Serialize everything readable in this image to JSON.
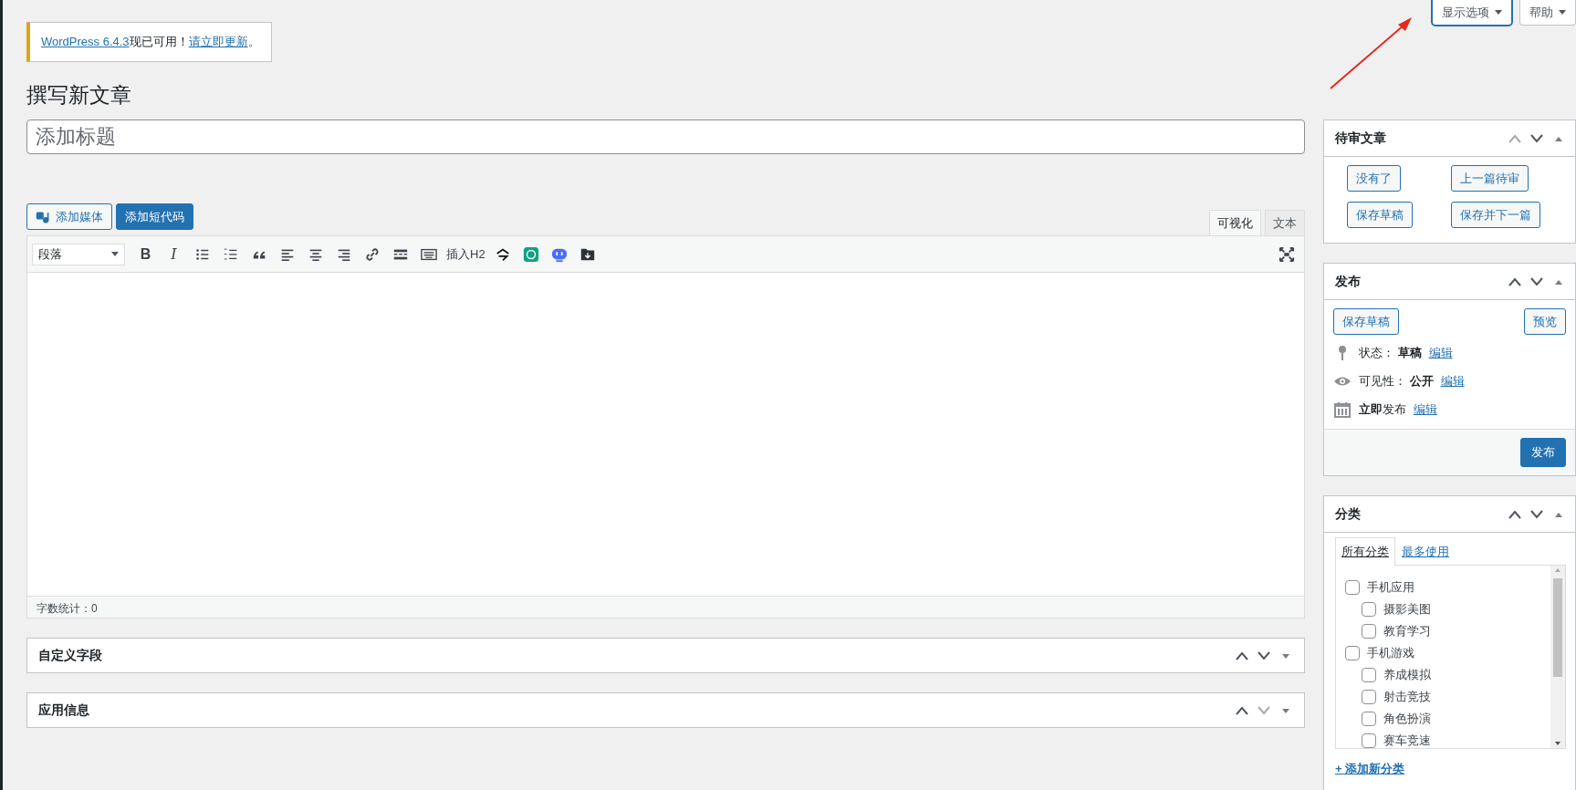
{
  "notice": {
    "parts": [
      {
        "kind": "link",
        "text": "WordPress 6.4.3"
      },
      {
        "kind": "text",
        "text": "现已可用！"
      },
      {
        "kind": "link",
        "text": "请立即更新"
      },
      {
        "kind": "text",
        "text": "。"
      }
    ]
  },
  "screen_meta": [
    {
      "label": "显示选项",
      "focused": true
    },
    {
      "label": "帮助",
      "focused": false
    }
  ],
  "heading": "撰写新文章",
  "title_field": {
    "placeholder": "添加标题"
  },
  "media_buttons": [
    {
      "label": "添加媒体",
      "kind": "media"
    },
    {
      "label": "添加短代码",
      "kind": "primary"
    }
  ],
  "editor_tabs": [
    {
      "label": "可视化",
      "selected": true
    },
    {
      "label": "文本",
      "selected": false
    }
  ],
  "toolbar": {
    "format_select": "段落",
    "items": [
      {
        "kind": "bold",
        "glyph": "B"
      },
      {
        "kind": "italic",
        "glyph": "I"
      },
      {
        "kind": "bullet-list"
      },
      {
        "kind": "number-list"
      },
      {
        "kind": "quote"
      },
      {
        "kind": "align-left"
      },
      {
        "kind": "align-center"
      },
      {
        "kind": "align-right"
      },
      {
        "kind": "link"
      },
      {
        "kind": "more"
      },
      {
        "kind": "keyboard"
      },
      {
        "kind": "text",
        "label": "插入H2"
      },
      {
        "kind": "squiggle"
      },
      {
        "kind": "chat"
      },
      {
        "kind": "robot"
      },
      {
        "kind": "download"
      }
    ]
  },
  "word_count": "字数统计：0",
  "postboxes": [
    {
      "title": "自定义字段",
      "up_disabled": false,
      "down_disabled": false
    },
    {
      "title": "应用信息",
      "up_disabled": false,
      "down_disabled": true
    }
  ],
  "sidebar": {
    "pending": {
      "title": "待审文章",
      "up_disabled": true,
      "down_disabled": false,
      "buttons": [
        "没有了",
        "上一篇待审",
        "保存草稿",
        "保存并下一篇"
      ]
    },
    "publish": {
      "title": "发布",
      "up_disabled": false,
      "down_disabled": false,
      "save_draft": "保存草稿",
      "preview": "预览",
      "rows": [
        {
          "kind": "status",
          "text": "状态： **草稿**",
          "link": "编辑"
        },
        {
          "kind": "visibility",
          "text": "可见性： **公开**",
          "link": "编辑"
        },
        {
          "kind": "schedule",
          "text": "**立即**发布",
          "link": "编辑"
        }
      ],
      "publish_button": "发布"
    },
    "categories": {
      "title": "分类",
      "up_disabled": false,
      "down_disabled": false,
      "tabs": [
        {
          "label": "所有分类",
          "selected": true
        },
        {
          "label": "最多使用",
          "selected": false
        }
      ],
      "items": [
        {
          "label": "手机应用",
          "checked": false,
          "children": [
            {
              "label": "摄影美图",
              "checked": false
            },
            {
              "label": "教育学习",
              "checked": false
            }
          ]
        },
        {
          "label": "手机游戏",
          "checked": false,
          "children": [
            {
              "label": "养成模拟",
              "checked": false
            },
            {
              "label": "射击竞技",
              "checked": false
            },
            {
              "label": "角色扮演",
              "checked": false
            },
            {
              "label": "赛车竞速",
              "checked": false
            }
          ]
        }
      ],
      "add_link": "+ 添加新分类"
    }
  }
}
